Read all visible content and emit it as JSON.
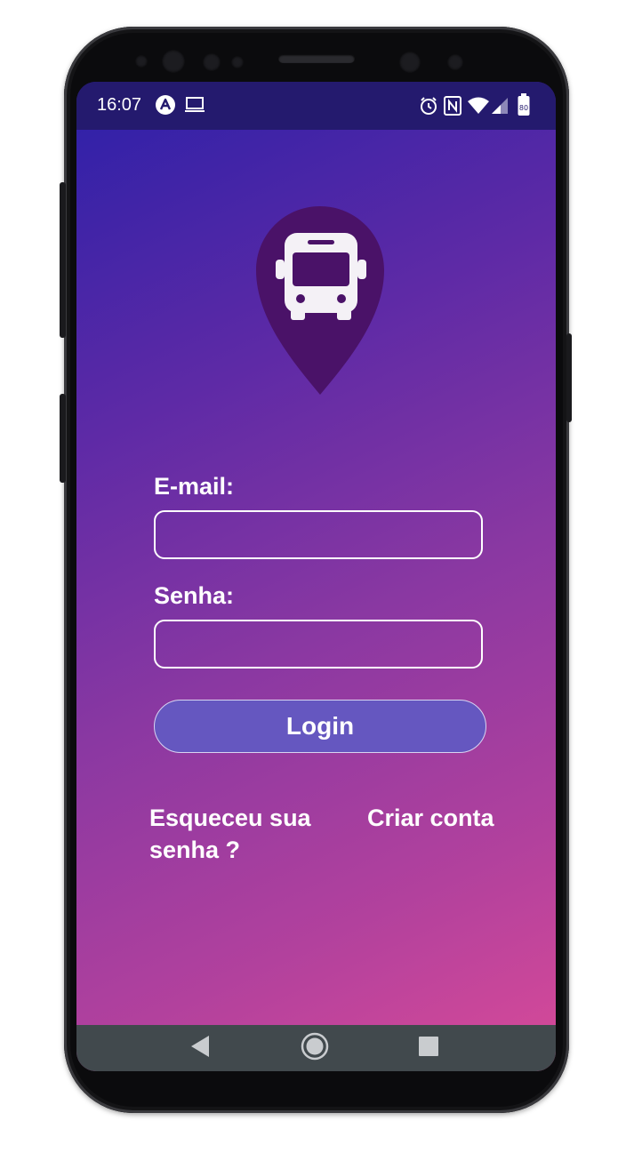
{
  "status_bar": {
    "time": "16:07",
    "left_icons": [
      "app-a-icon",
      "laptop-icon"
    ],
    "right_icons": [
      "alarm-icon",
      "nfc-icon",
      "wifi-icon",
      "signal-icon",
      "battery-icon"
    ],
    "battery_level": "80"
  },
  "logo": {
    "icon": "bus-location-pin-icon",
    "pin_color": "#4a1268",
    "bus_color": "#f4f1f6"
  },
  "form": {
    "email_label": "E-mail:",
    "email_value": "",
    "password_label": "Senha:",
    "password_value": "",
    "login_label": "Login"
  },
  "links": {
    "forgot_password_line1": "Esqueceu sua",
    "forgot_password_line2": "senha ?",
    "create_account": "Criar conta"
  },
  "nav_bar": {
    "buttons": [
      "back-icon",
      "home-icon",
      "recents-icon"
    ]
  },
  "colors": {
    "gradient_start": "#2c20a8",
    "gradient_end": "#d84a98",
    "status_bar": "#241a6e",
    "button": "#6557c0",
    "nav_bar": "#41494d"
  }
}
